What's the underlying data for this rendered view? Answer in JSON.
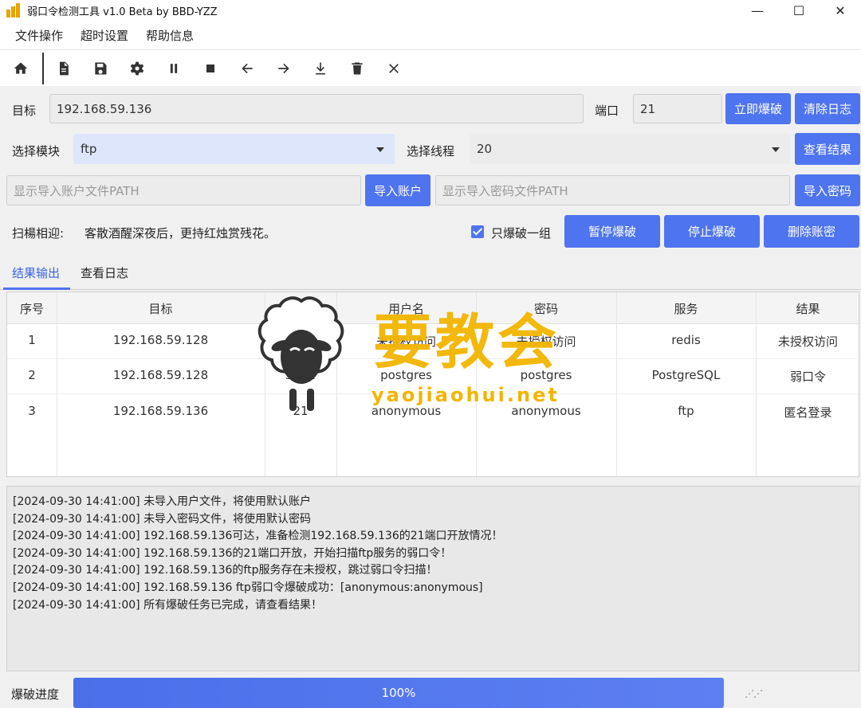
{
  "window": {
    "title": "弱口令检测工具 v1.0 Beta by BBD-YZZ",
    "controls": [
      "—",
      "☐",
      "✕"
    ]
  },
  "menu": [
    "文件操作",
    "超时设置",
    "帮助信息"
  ],
  "toolbar": {
    "icons": [
      "home-icon",
      "file-icon",
      "save-icon",
      "gear-icon",
      "pause-icon",
      "stop-icon",
      "arrow-left-icon",
      "arrow-right-icon",
      "download-icon",
      "trash-icon",
      "close-icon"
    ]
  },
  "target_row": {
    "label": "目标",
    "value": "192.168.59.136",
    "port_label": "端口",
    "port_value": "21",
    "start_button": "立即爆破",
    "clear_log_button": "清除日志"
  },
  "module_row": {
    "module_label": "选择模块",
    "module_value": "ftp",
    "thread_label": "选择线程",
    "thread_value": "20",
    "view_results_button": "查看结果"
  },
  "import_row": {
    "user_path_placeholder": "显示导入账户文件PATH",
    "import_user_button": "导入账户",
    "pass_path_placeholder": "显示导入密码文件PATH",
    "import_pass_button": "导入密码"
  },
  "scan_row": {
    "label": "扫楊相迎:",
    "motto": "客散酒醒深夜后，更持红烛赏残花。",
    "only_one_label": "只爆破一组",
    "only_one_checked": true,
    "pause_button": "暂停爆破",
    "stop_button": "停止爆破",
    "delete_button": "删除账密"
  },
  "tabs": [
    "结果输出",
    "查看日志"
  ],
  "results": {
    "headers": [
      "序号",
      "目标",
      "端口",
      "用户名",
      "密码",
      "服务",
      "结果"
    ],
    "rows": [
      [
        "1",
        "192.168.59.128",
        "6379",
        "未授权访问",
        "未授权访问",
        "redis",
        "未授权访问"
      ],
      [
        "2",
        "192.168.59.128",
        "5432",
        "postgres",
        "postgres",
        "PostgreSQL",
        "弱口令"
      ],
      [
        "3",
        "192.168.59.136",
        "21",
        "anonymous",
        "anonymous",
        "ftp",
        "匿名登录"
      ]
    ]
  },
  "log": [
    "[2024-09-30 14:41:00] 未导入用户文件，将使用默认账户",
    "[2024-09-30 14:41:00] 未导入密码文件，将使用默认密码",
    "[2024-09-30 14:41:00] 192.168.59.136可达，准备检测192.168.59.136的21端口开放情况！",
    "[2024-09-30 14:41:00] 192.168.59.136的21端口开放，开始扫描ftp服务的弱口令！",
    "[2024-09-30 14:41:00] 192.168.59.136的ftp服务存在未授权，跳过弱口令扫描！",
    "[2024-09-30 14:41:00] 192.168.59.136 ftp弱口令爆破成功：[anonymous:anonymous]",
    "[2024-09-30 14:41:00] 所有爆破任务已完成，请查看结果！"
  ],
  "progress": {
    "label": "爆破进度",
    "value": 100,
    "text": "100%"
  },
  "watermark": {
    "text": "要教会",
    "url": "yaojiaohui.net"
  },
  "colors": {
    "accent": "#4f74ef",
    "tab_active": "#3b63e3",
    "watermark": "#f2b500"
  }
}
